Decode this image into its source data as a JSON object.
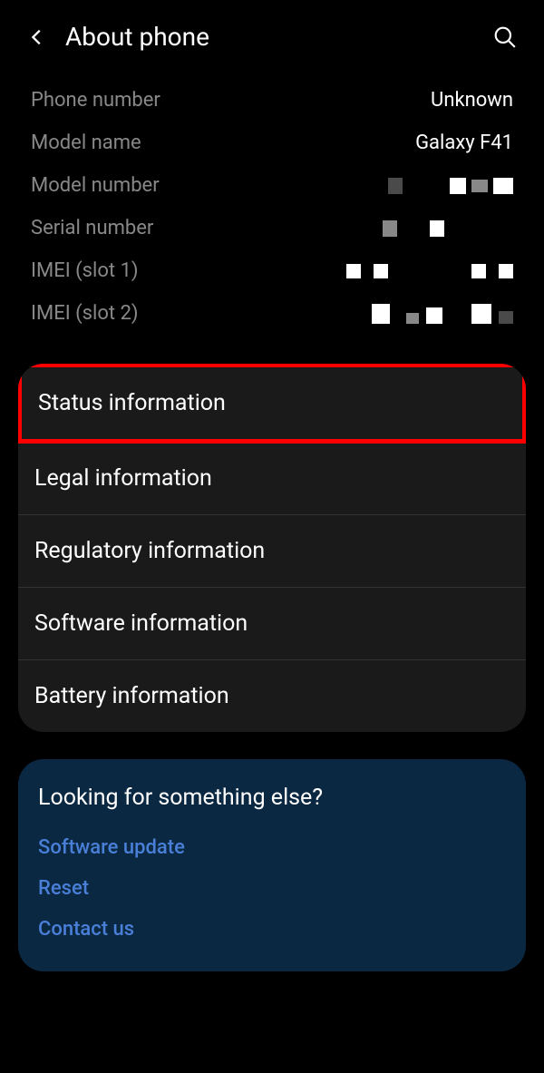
{
  "header": {
    "title": "About phone"
  },
  "info": {
    "phone_number": {
      "label": "Phone number",
      "value": "Unknown"
    },
    "model_name": {
      "label": "Model name",
      "value": "Galaxy F41"
    },
    "model_number": {
      "label": "Model number"
    },
    "serial_number": {
      "label": "Serial number"
    },
    "imei1": {
      "label": "IMEI (slot 1)"
    },
    "imei2": {
      "label": "IMEI (slot 2)"
    }
  },
  "menu": {
    "status": "Status information",
    "legal": "Legal information",
    "regulatory": "Regulatory information",
    "software": "Software information",
    "battery": "Battery information"
  },
  "suggestions": {
    "title": "Looking for something else?",
    "software_update": "Software update",
    "reset": "Reset",
    "contact": "Contact us"
  }
}
